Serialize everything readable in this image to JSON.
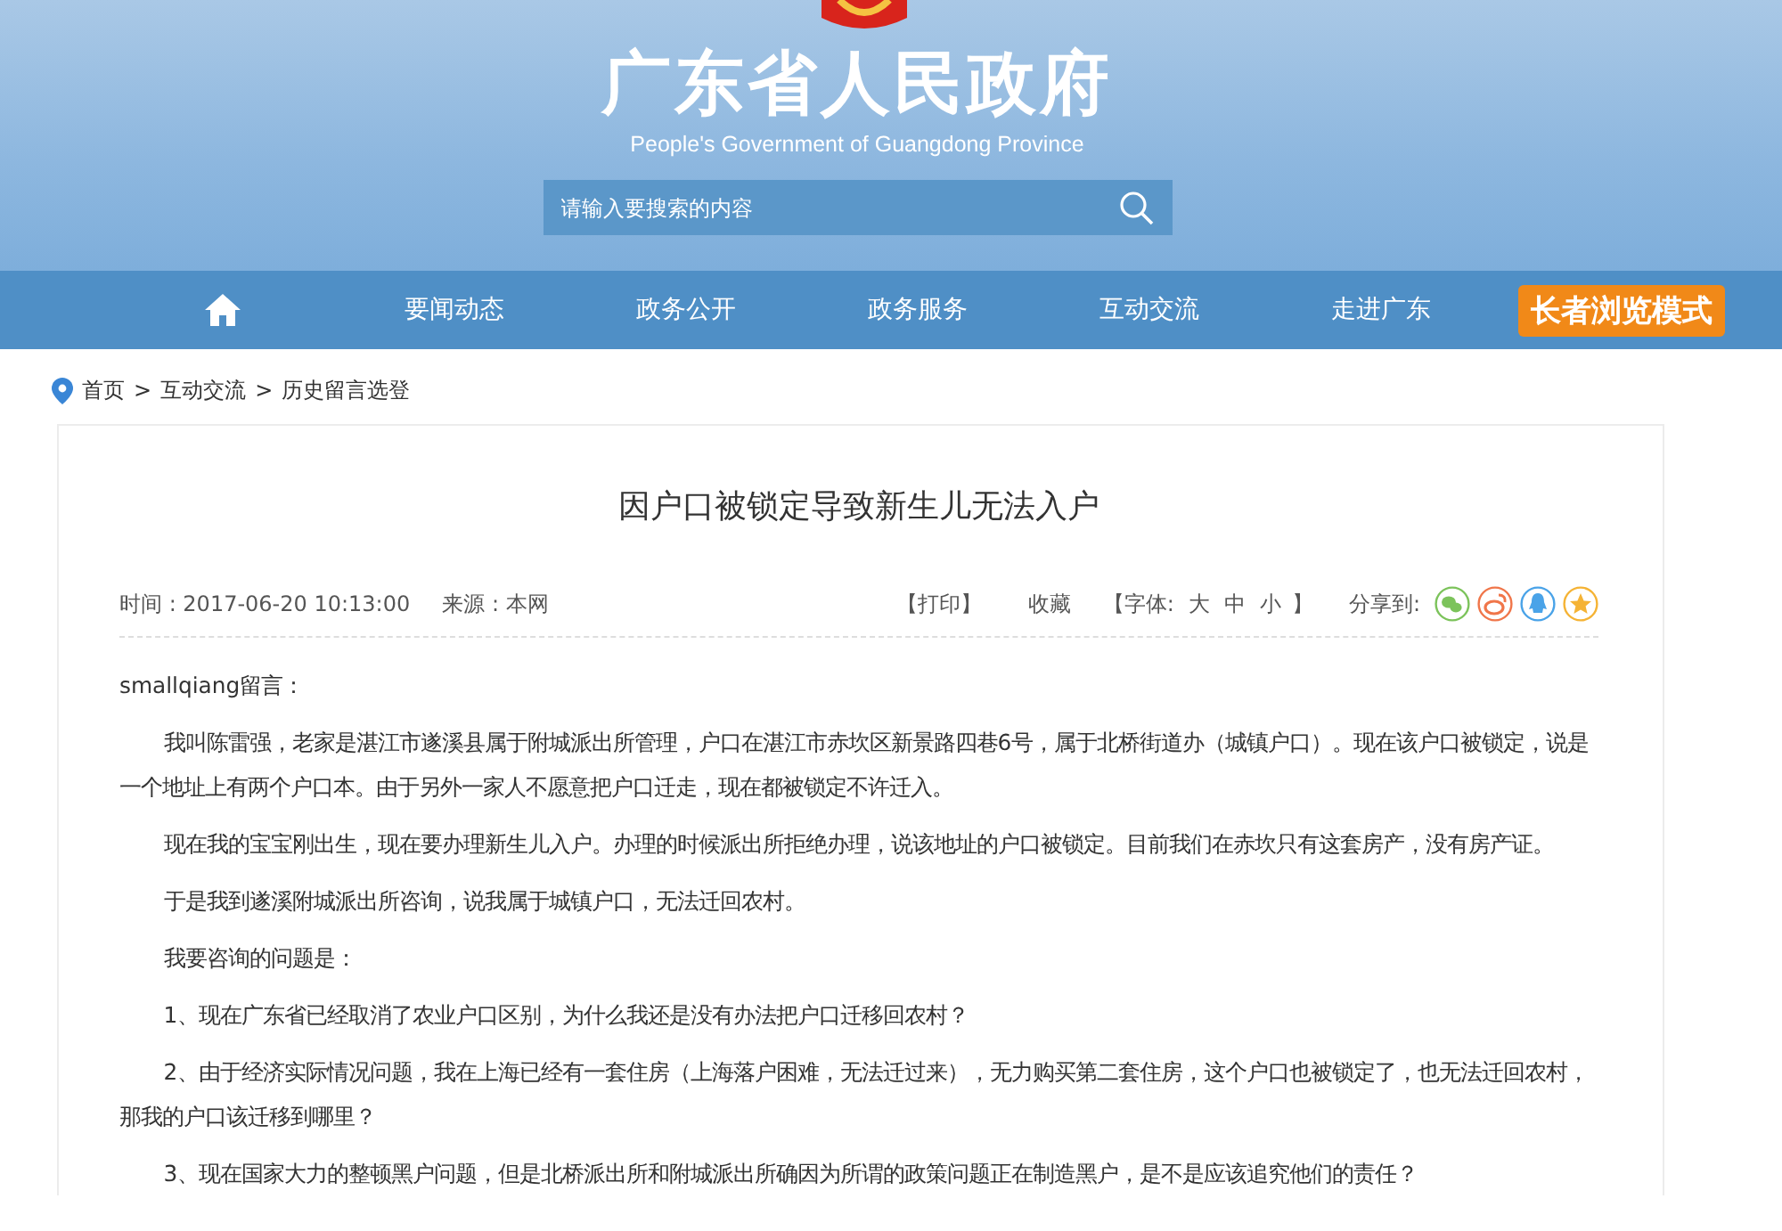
{
  "header": {
    "title": "广东省人民政府",
    "subtitle": "People's Government of Guangdong Province",
    "search": {
      "placeholder": "请输入要搜索的内容"
    }
  },
  "nav": {
    "items": [
      {
        "kind": "home"
      },
      {
        "kind": "link",
        "label": "要闻动态"
      },
      {
        "kind": "link",
        "label": "政务公开"
      },
      {
        "kind": "link",
        "label": "政务服务"
      },
      {
        "kind": "link",
        "label": "互动交流"
      },
      {
        "kind": "link",
        "label": "走进广东"
      },
      {
        "kind": "mode",
        "label": "长者浏览模式"
      }
    ]
  },
  "breadcrumb": {
    "separator": ">",
    "items": [
      "首页",
      "互动交流",
      "历史留言选登"
    ]
  },
  "article": {
    "title": "因户口被锁定导致新生儿无法入户",
    "time": "时间 : 2017-06-20 10:13:00",
    "source": "来源 : 本网",
    "print": "【打印】",
    "favorite": "收藏",
    "font_size": {
      "label": "【字体:",
      "options": [
        "大",
        "中",
        "小"
      ],
      "close": "】"
    },
    "share": {
      "label": "分享到:",
      "buttons": [
        {
          "kind": "wechat",
          "color": "#7cc35b"
        },
        {
          "kind": "weibo",
          "color": "#f0764a"
        },
        {
          "kind": "qq",
          "color": "#4aa3e8"
        },
        {
          "kind": "star",
          "color": "#f5b335"
        }
      ]
    },
    "paragraphs": [
      {
        "kind": "author",
        "text": "smallqiang留言："
      },
      {
        "kind": "body",
        "text": "我叫陈雷强，老家是湛江市遂溪县属于附城派出所管理，户口在湛江市赤坎区新景路四巷6号，属于北桥街道办（城镇户口）。现在该户口被锁定，说是一个地址上有两个户口本。由于另外一家人不愿意把户口迁走，现在都被锁定不许迁入。"
      },
      {
        "kind": "body",
        "text": "现在我的宝宝刚出生，现在要办理新生儿入户。办理的时候派出所拒绝办理，说该地址的户口被锁定。目前我们在赤坎只有这套房产，没有房产证。"
      },
      {
        "kind": "body",
        "text": "于是我到遂溪附城派出所咨询，说我属于城镇户口，无法迁回农村。"
      },
      {
        "kind": "body",
        "text": "我要咨询的问题是："
      },
      {
        "kind": "body",
        "text": "1、现在广东省已经取消了农业户口区别，为什么我还是没有办法把户口迁移回农村？"
      },
      {
        "kind": "body",
        "text": "2、由于经济实际情况问题，我在上海已经有一套住房（上海落户困难，无法迁过来），无力购买第二套住房，这个户口也被锁定了，也无法迁回农村，那我的户口该迁移到哪里？"
      },
      {
        "kind": "body",
        "text": "3、现在国家大力的整顿黑户问题，但是北桥派出所和附城派出所确因为所谓的政策问题正在制造黑户，是不是应该追究他们的责任？"
      }
    ]
  }
}
